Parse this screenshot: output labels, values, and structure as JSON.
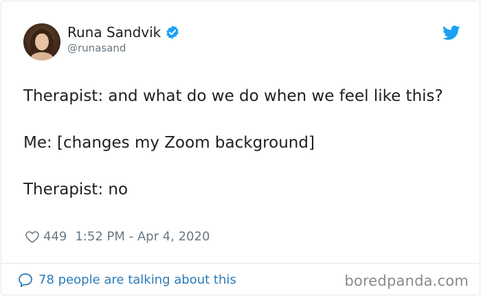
{
  "author": {
    "name": "Runa Sandvik",
    "handle": "@runasand",
    "verified": true
  },
  "tweet": {
    "lines": [
      "Therapist: and what do we do when we feel like this?",
      "Me: [changes my Zoom background]",
      "Therapist: no"
    ]
  },
  "meta": {
    "likes": "449",
    "timestamp": "1:52 PM - Apr 4, 2020"
  },
  "footer": {
    "talking": "78 people are talking about this"
  },
  "watermark": "boredpanda.com",
  "icons": {
    "verified": "verified-badge-icon",
    "brand": "twitter-bird-icon",
    "like": "heart-icon",
    "reply": "speech-bubble-icon"
  },
  "colors": {
    "brand": "#1da1f2",
    "link": "#2b7bb9",
    "muted": "#697882",
    "text": "#1c2022"
  }
}
